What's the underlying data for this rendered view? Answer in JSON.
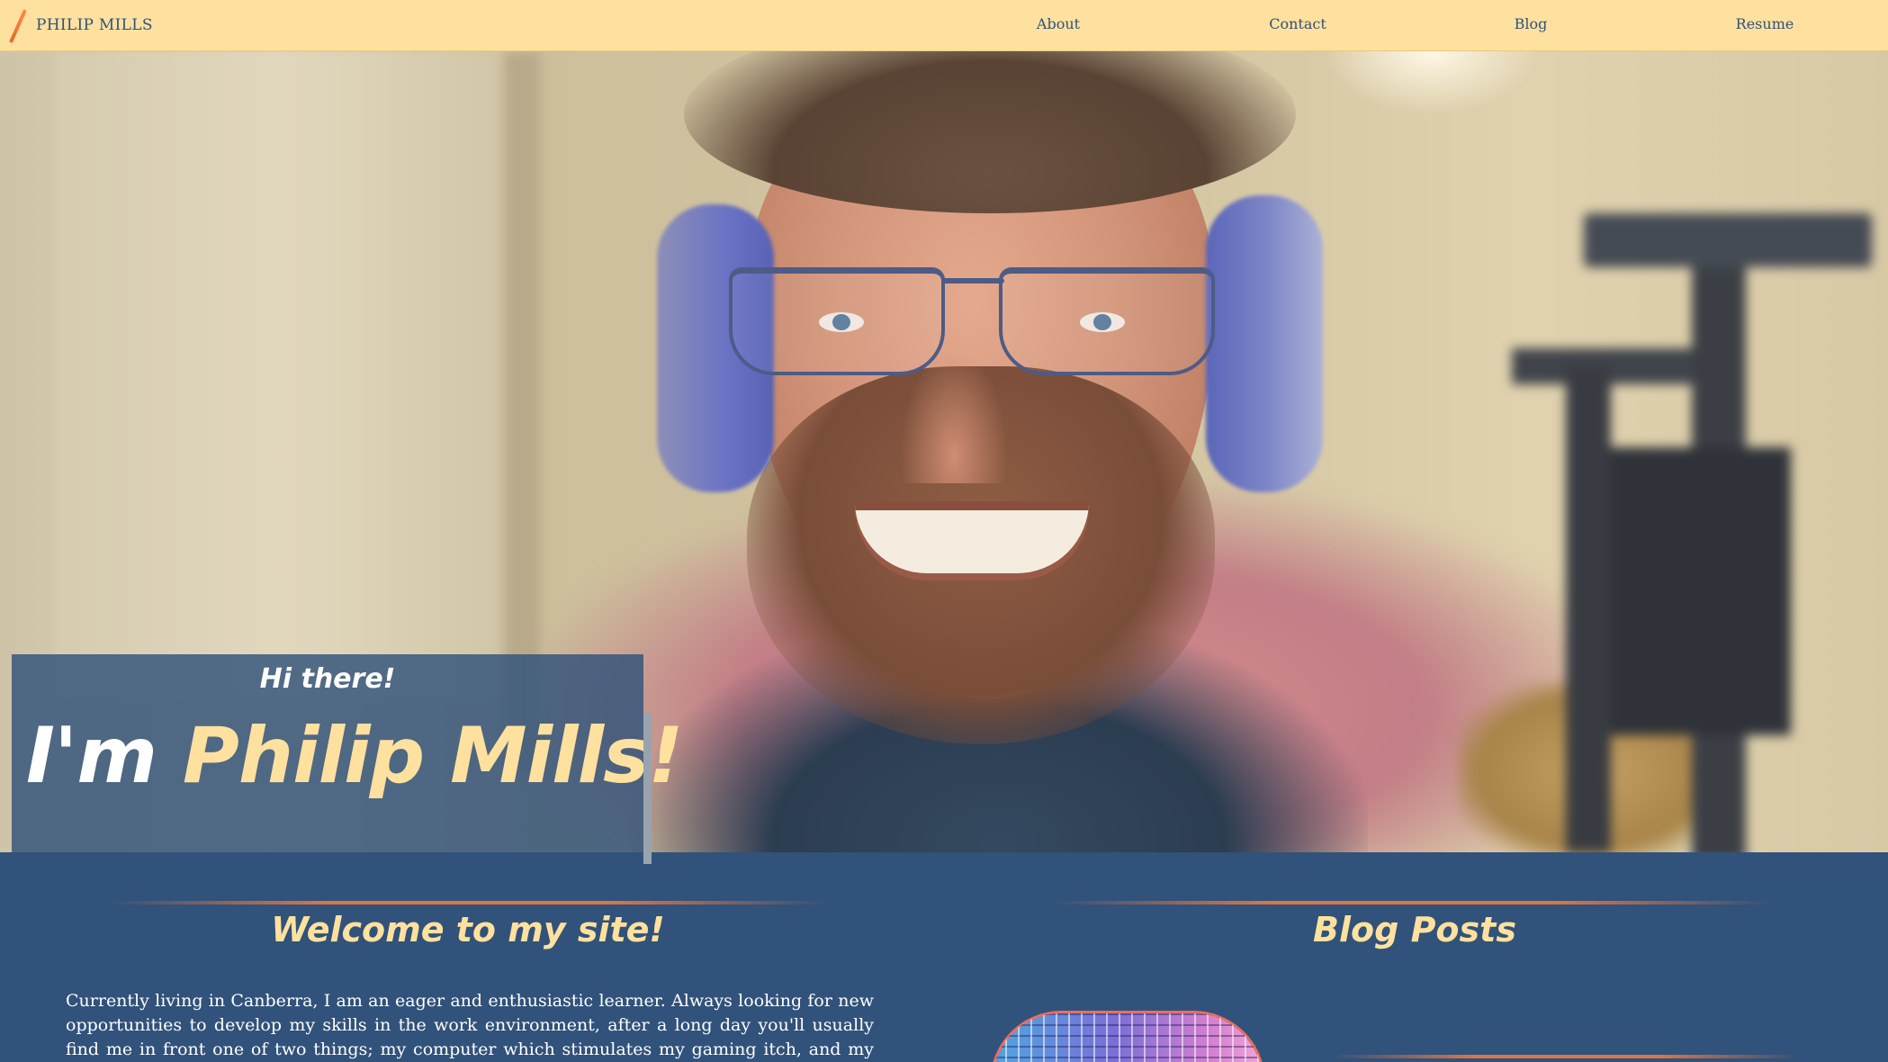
{
  "navbar": {
    "brand": "PHILIP MILLS",
    "links": [
      "About",
      "Contact",
      "Blog",
      "Resume"
    ]
  },
  "hero": {
    "greeting": "Hi there!",
    "headline_prefix": "I'm",
    "headline_name": "Philip Mills!"
  },
  "welcome": {
    "title": "Welcome to my site!",
    "text": "Currently living in Canberra, I am an eager and enthusiastic learner. Always looking for new opportunities to develop my skills in the work environment, after a long day you'll usually find me in front one of two things; my computer which stimulates my gaming itch, and my tablet where I'm"
  },
  "blog": {
    "title": "Blog Posts"
  },
  "colors": {
    "navbar_bg": "#ffe19f",
    "primary_blue": "#31527a",
    "accent_yellow": "#ffe19f",
    "accent_orange": "#d97548",
    "text_white": "#ffffff"
  },
  "icons": {
    "brand_mark": "orange-slash-icon"
  }
}
